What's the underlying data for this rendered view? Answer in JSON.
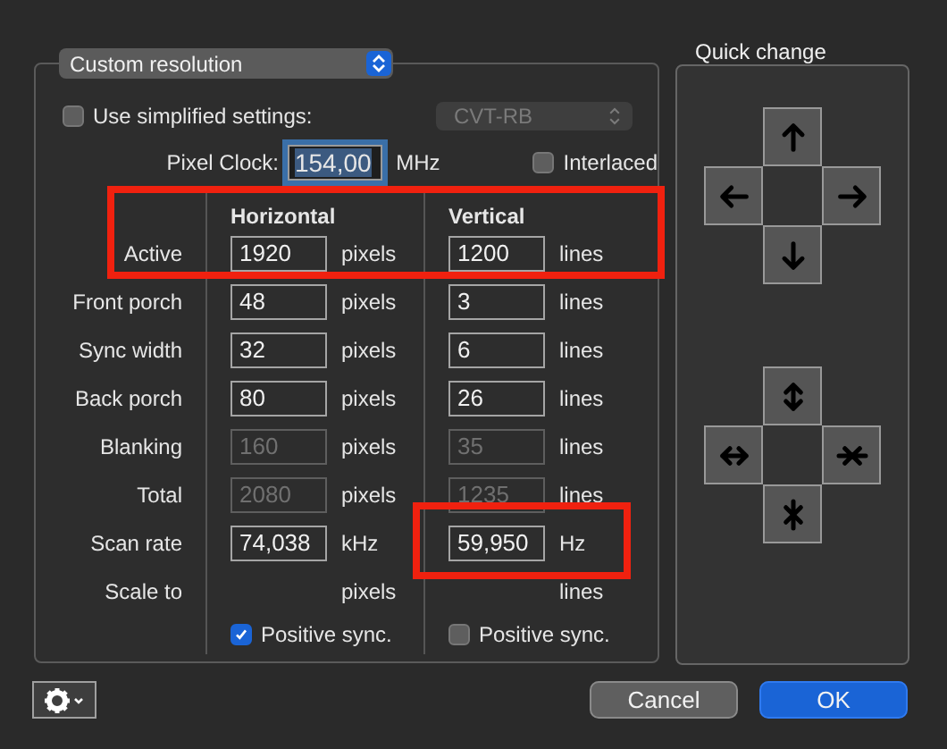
{
  "popup": {
    "value": "Custom resolution"
  },
  "simplified": {
    "label": "Use simplified settings:",
    "checked": false
  },
  "preset": {
    "value": "CVT-RB",
    "disabled": true
  },
  "pixel_clock": {
    "label": "Pixel Clock:",
    "value": "154,00",
    "unit": "MHz",
    "focused": true
  },
  "interlaced": {
    "label": "Interlaced",
    "checked": false
  },
  "columns": [
    "Horizontal",
    "Vertical"
  ],
  "rows": [
    {
      "label": "Active",
      "h": {
        "value": "1920",
        "unit": "pixels",
        "disabled": false
      },
      "v": {
        "value": "1200",
        "unit": "lines",
        "disabled": false
      }
    },
    {
      "label": "Front porch",
      "h": {
        "value": "48",
        "unit": "pixels",
        "disabled": false
      },
      "v": {
        "value": "3",
        "unit": "lines",
        "disabled": false
      }
    },
    {
      "label": "Sync width",
      "h": {
        "value": "32",
        "unit": "pixels",
        "disabled": false
      },
      "v": {
        "value": "6",
        "unit": "lines",
        "disabled": false
      }
    },
    {
      "label": "Back porch",
      "h": {
        "value": "80",
        "unit": "pixels",
        "disabled": false
      },
      "v": {
        "value": "26",
        "unit": "lines",
        "disabled": false
      }
    },
    {
      "label": "Blanking",
      "h": {
        "value": "160",
        "unit": "pixels",
        "disabled": true
      },
      "v": {
        "value": "35",
        "unit": "lines",
        "disabled": true
      }
    },
    {
      "label": "Total",
      "h": {
        "value": "2080",
        "unit": "pixels",
        "disabled": true
      },
      "v": {
        "value": "1235",
        "unit": "lines",
        "disabled": true
      }
    },
    {
      "label": "Scan rate",
      "h": {
        "value": "74,038",
        "unit": "kHz",
        "disabled": false
      },
      "v": {
        "value": "59,950",
        "unit": "Hz",
        "disabled": false
      }
    },
    {
      "label": "Scale to",
      "h": {
        "unit": "pixels"
      },
      "v": {
        "unit": "lines"
      }
    }
  ],
  "sync": [
    {
      "label": "Positive sync.",
      "checked": true
    },
    {
      "label": "Positive sync.",
      "checked": false
    }
  ],
  "quick_change": {
    "title": "Quick change"
  },
  "buttons": [
    {
      "label": "Cancel",
      "kind": "cancel"
    },
    {
      "label": "OK",
      "kind": "default"
    }
  ],
  "highlights": [
    {
      "kind": "box"
    },
    {
      "kind": "box"
    }
  ]
}
